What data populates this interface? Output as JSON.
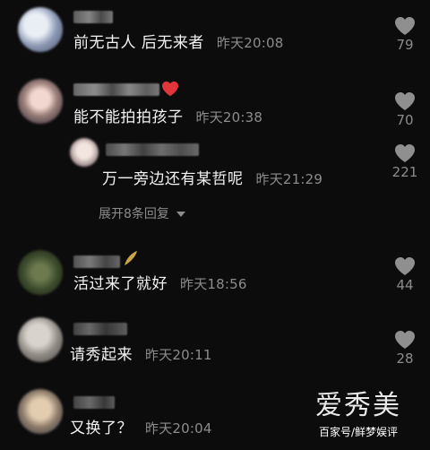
{
  "comments": [
    {
      "text": "前无古人 后无来者",
      "time": "昨天20:08",
      "likes": "79"
    },
    {
      "text": "能不能拍拍孩子",
      "time": "昨天20:38",
      "likes": "70"
    },
    {
      "text": "万一旁边还有某哲呢",
      "time": "昨天21:29",
      "likes": "221",
      "is_reply": true
    },
    {
      "text": "活过来了就好",
      "time": "昨天18:56",
      "likes": "44"
    },
    {
      "text": "请秀起来",
      "time": "昨天20:11",
      "likes": "28"
    },
    {
      "text": "又换了？",
      "time": "昨天20:04",
      "likes": ""
    }
  ],
  "expand_replies": "展开8条回复",
  "watermark": {
    "brand": "爱秀美",
    "sub": "百家号/鲜梦娱评"
  },
  "colors": {
    "background": "#0c0c0d",
    "primary_text": "#f3f3f3",
    "secondary_text": "#8c8c8c",
    "heart_icon": "#8f8f8f",
    "red_badge": "#e0353a"
  },
  "icons": {
    "like": "heart-icon",
    "expand": "caret-down-icon"
  }
}
